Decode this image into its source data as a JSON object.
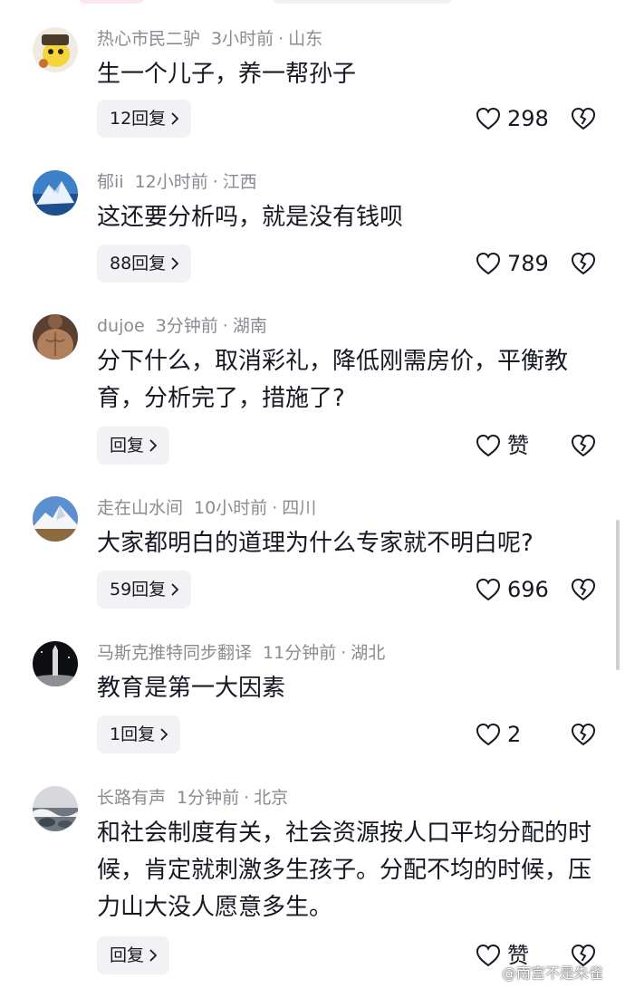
{
  "comments": [
    {
      "username": "热心市民二驴",
      "time": "3小时前",
      "location": "山东",
      "text": "生一个儿子，养一帮孙子",
      "reply_label": "12回复",
      "likes": "298"
    },
    {
      "username": "郁ii",
      "time": "12小时前",
      "location": "江西",
      "text": "这还要分析吗，就是没有钱呗",
      "reply_label": "88回复",
      "likes": "789"
    },
    {
      "username": "dujoe",
      "time": "3分钟前",
      "location": "湖南",
      "text": "分下什么，取消彩礼，降低刚需房价，平衡教育，分析完了，措施了?",
      "reply_label": "回复",
      "likes": "赞"
    },
    {
      "username": "走在山水间",
      "time": "10小时前",
      "location": "四川",
      "text": "大家都明白的道理为什么专家就不明白呢?",
      "reply_label": "59回复",
      "likes": "696"
    },
    {
      "username": "马斯克推特同步翻译",
      "time": "11分钟前",
      "location": "湖北",
      "text": "教育是第一大因素",
      "reply_label": "1回复",
      "likes": "2"
    },
    {
      "username": "长路有声",
      "time": "1分钟前",
      "location": "北京",
      "text": "和社会制度有关，社会资源按人口平均分配的时候，肯定就刺激多生孩子。分配不均的时候，压力山大没人愿意多生。",
      "reply_label": "回复",
      "likes": "赞"
    }
  ],
  "separator": "·",
  "watermark": "@南宫不是朱雀",
  "icons": {
    "like": "heart-outline-icon",
    "dislike": "broken-heart-icon",
    "reply": "chevron-right-icon",
    "watermark": "weibo-logo-icon"
  },
  "colors": {
    "text": "#161823",
    "meta": "#8a8b91",
    "reply_bg": "#f2f2f4"
  }
}
